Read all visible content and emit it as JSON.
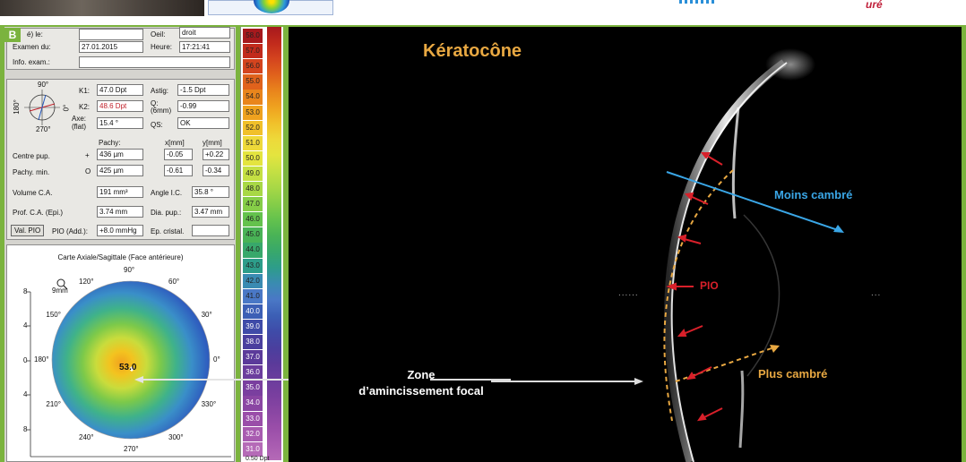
{
  "top": {
    "red_text": "uré"
  },
  "panel_label": "B",
  "exam": {
    "created_label": "é) le:",
    "created_value": "",
    "eye_label": "Oeil:",
    "eye_value": "droit",
    "exam_date_label": "Examen du:",
    "exam_date_value": "27.01.2015",
    "time_label": "Heure:",
    "time_value": "17:21:41",
    "info_label": "Info. exam.:",
    "info_value": ""
  },
  "kerato": {
    "deg_90": "90°",
    "deg_180": "180°",
    "deg_270": "270°",
    "deg_0": "0°",
    "k1_label": "K1:",
    "k1_value": "47.0 Dpt",
    "k2_label": "K2:",
    "k2_value": "48.6 Dpt",
    "axe_label": "Axe:",
    "axe_sub": "(flat)",
    "axe_value": "15.4 °",
    "astig_label": "Astig:",
    "astig_value": "-1.5 Dpt",
    "q_label": "Q:",
    "q_sub": "(6mm)",
    "q_value": "-0.99",
    "qs_label": "QS:",
    "qs_value": "OK"
  },
  "pachy": {
    "col_pachy": "Pachy:",
    "col_x": "x[mm]",
    "col_y": "y[mm]",
    "centre_label": "Centre pup.",
    "centre_sym": "+",
    "centre_pachy": "436 µm",
    "centre_x": "-0.05",
    "centre_y": "+0.22",
    "min_label": "Pachy. min.",
    "min_sym": "O",
    "min_pachy": "425 µm",
    "min_x": "-0.61",
    "min_y": "-0.34"
  },
  "chamber": {
    "volume_label": "Volume C.A.",
    "volume_value": "191 mm³",
    "angle_label": "Angle I.C.",
    "angle_value": "35.8 °",
    "prof_label": "Prof. C.A. (Epi.)",
    "prof_value": "3.74 mm",
    "dia_label": "Dia. pup.:",
    "dia_value": "3.47 mm",
    "valpio_button": "Val. PIO",
    "pio_label": "PIO (Add.):",
    "pio_value": "+8.0 mmHg",
    "ep_label": "Ep. cristal.",
    "ep_value": ""
  },
  "map": {
    "title": "Carte Axiale/Sagittale (Face antérieure)",
    "zoom_label": "9mm",
    "center_value": "53.0",
    "y_ticks": [
      "8",
      "4",
      "0",
      "4",
      "8"
    ],
    "angle_labels": [
      "90°",
      "60°",
      "30°",
      "0°",
      "330°",
      "300°",
      "270°",
      "240°",
      "210°",
      "180°",
      "150°",
      "120°"
    ]
  },
  "scale": {
    "values": [
      "58.0",
      "57.0",
      "56.0",
      "55.0",
      "54.0",
      "53.0",
      "52.0",
      "51.0",
      "50.0",
      "49.0",
      "48.0",
      "47.0",
      "46.0",
      "45.0",
      "44.0",
      "43.0",
      "42.0",
      "41.0",
      "40.0",
      "39.0",
      "38.0",
      "37.0",
      "36.0",
      "35.0",
      "34.0",
      "33.0",
      "32.0",
      "31.0"
    ],
    "colors": [
      "#a6191d",
      "#c12a1c",
      "#d4441e",
      "#e0621c",
      "#e9851c",
      "#efa21f",
      "#f1c02a",
      "#eed93a",
      "#e4e43f",
      "#c5e043",
      "#a8d846",
      "#86ce48",
      "#64c24d",
      "#49b356",
      "#38a86b",
      "#2d9d8a",
      "#3a8bb2",
      "#4a78c6",
      "#3c5fb5",
      "#3f4ba8",
      "#4a3f9e",
      "#5b3a9a",
      "#6b3d9d",
      "#7a3f9f",
      "#8a46a3",
      "#9a4ea9",
      "#a85bb0",
      "#b56ab7"
    ],
    "unit": "0.50 Dpt"
  },
  "annotations": {
    "title": "Kératocône",
    "moins": "Moins cambré",
    "pio": "PIO",
    "plus": "Plus cambré",
    "zone_line1": "Zone",
    "zone_line2": "d’amincissement focal",
    "dots": "......",
    "dots_right": "..."
  },
  "colors": {
    "frame_green": "#7bb33e",
    "title_orange": "#e8a842",
    "blue_label": "#3aa6e6",
    "red_arrow": "#d8202a"
  }
}
